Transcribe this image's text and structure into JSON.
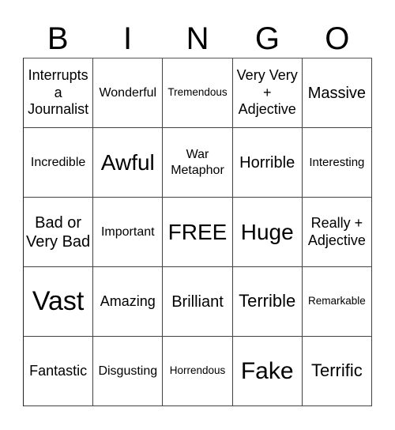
{
  "header": {
    "letters": [
      "B",
      "I",
      "N",
      "G",
      "O"
    ]
  },
  "board": {
    "rows": [
      [
        "Interrupts a Journalist",
        "Wonderful",
        "Tremendous",
        "Very Very + Adjective",
        "Massive"
      ],
      [
        "Incredible",
        "Awful",
        "War Metaphor",
        "Horrible",
        "Interesting"
      ],
      [
        "Bad or Very Bad",
        "Important",
        "FREE",
        "Huge",
        "Really + Adjective"
      ],
      [
        "Vast",
        "Amazing",
        "Brilliant",
        "Terrible",
        "Remarkable"
      ],
      [
        "Fantastic",
        "Disgusting",
        "Horrendous",
        "Fake",
        "Terrific"
      ]
    ],
    "free_space": "FREE"
  }
}
